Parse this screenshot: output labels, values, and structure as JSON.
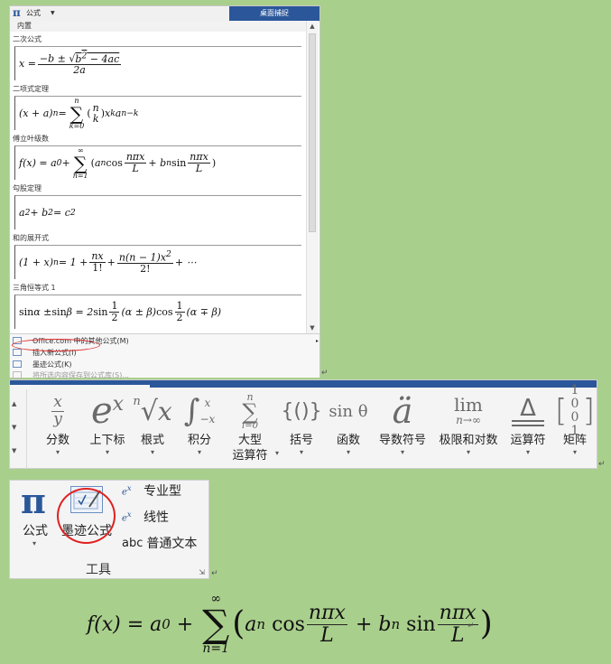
{
  "gallery": {
    "button_label": "公式",
    "caption": "桌面捕捉",
    "section": "内置",
    "items": [
      {
        "title": "二次公式"
      },
      {
        "title": "二项式定理"
      },
      {
        "title": "傅立叶级数"
      },
      {
        "title": "勾股定理"
      },
      {
        "title": "和的展开式"
      },
      {
        "title": "三角恒等式 1"
      }
    ],
    "menu": [
      {
        "label": "Office.com 中的其他公式(M)"
      },
      {
        "label": "插入新公式(I)"
      },
      {
        "label": "墨迹公式(K)"
      },
      {
        "label": "将所选内容保存到公式库(S)..."
      }
    ]
  },
  "ribbon": {
    "buttons": [
      {
        "label": "分数"
      },
      {
        "label": "上下标"
      },
      {
        "label": "根式"
      },
      {
        "label": "积分"
      },
      {
        "label": "大型",
        "label2": "运算符"
      },
      {
        "label": "括号"
      },
      {
        "label": "函数"
      },
      {
        "label": "导数符号"
      },
      {
        "label": "极限和对数"
      },
      {
        "label": "运算符"
      },
      {
        "label": "矩阵"
      }
    ]
  },
  "tools": {
    "equation_label": "公式",
    "ink_label": "墨迹公式",
    "professional": "专业型",
    "linear": "线性",
    "plain_text": "普通文本",
    "abc": "abc",
    "group_label": "工具"
  },
  "colors": {
    "background": "#a9cf8c",
    "accent": "#2b579a",
    "highlight_ring": "#e02020"
  }
}
